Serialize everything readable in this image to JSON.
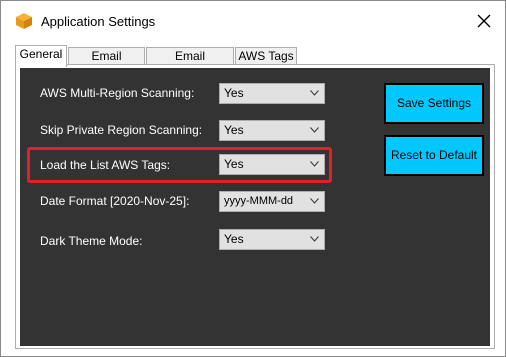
{
  "window": {
    "title": "Application Settings",
    "close_icon": "close-icon",
    "app_icon": "box-icon"
  },
  "tabs": [
    {
      "label": "General",
      "active": true
    },
    {
      "label": "Email Settings",
      "active": false
    },
    {
      "label": "Email Recipients",
      "active": false
    },
    {
      "label": "AWS Tags",
      "active": false
    }
  ],
  "settings": [
    {
      "label": "AWS Multi-Region Scanning:",
      "value": "Yes"
    },
    {
      "label": "Skip Private Region Scanning:",
      "value": "Yes"
    },
    {
      "label": "Load the List AWS Tags:",
      "value": "Yes"
    },
    {
      "label": "Date Format [2020-Nov-25]:",
      "value": "yyyy-MMM-dd"
    },
    {
      "label": "Dark Theme Mode:",
      "value": "Yes"
    }
  ],
  "buttons": {
    "save": "Save Settings",
    "reset": "Reset to Default"
  },
  "colors": {
    "panel_bg": "#333333",
    "button_bg": "#00c8ff",
    "highlight": "#e0202a"
  }
}
